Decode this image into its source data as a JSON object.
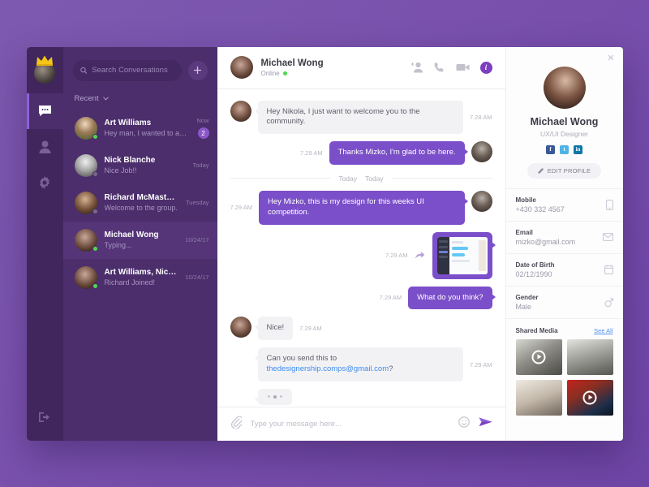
{
  "colors": {
    "accent": "#7b4fc9",
    "rail_bg": "#41265e",
    "sidebar_bg": "#4b2e6b",
    "selected_row": "#553578",
    "link": "#3d8cf0",
    "online": "#4ddb4d"
  },
  "rail": {
    "avatar_name": "user-avatar-crown",
    "items": [
      {
        "icon": "chat-bubble-icon",
        "name": "rail-item-chats",
        "active": true
      },
      {
        "icon": "person-icon",
        "name": "rail-item-contacts",
        "active": false
      },
      {
        "icon": "gear-icon",
        "name": "rail-item-settings",
        "active": false
      }
    ],
    "logout_icon": "logout-icon"
  },
  "sidebar": {
    "search": {
      "placeholder": "Search Conversations",
      "value": "",
      "icon": "search-icon"
    },
    "add_button_icon": "plus-icon",
    "filter_label": "Recent",
    "filter_chevron": "chevron-down-icon",
    "conversations": [
      {
        "name": "Art Williams",
        "preview": "Hey man, I wanted to ask...",
        "time": "Now",
        "badge": "2",
        "online": true,
        "selected": false
      },
      {
        "name": "Nick Blanche",
        "preview": "Nice Job!!",
        "time": "Today",
        "badge": "",
        "online": false,
        "selected": false
      },
      {
        "name": "Richard McMasters",
        "preview": "Welcome to the group.",
        "time": "Tuesday",
        "badge": "",
        "online": false,
        "selected": false
      },
      {
        "name": "Michael Wong",
        "preview": "Typing...",
        "time": "10/24/17",
        "badge": "",
        "online": true,
        "selected": true
      },
      {
        "name": "Art Williams, Nick B...",
        "preview": "Richard Joined!",
        "time": "10/24/17",
        "badge": "",
        "online": true,
        "selected": false
      }
    ]
  },
  "chat_header": {
    "name": "Michael Wong",
    "status": "Online",
    "actions": [
      {
        "icon": "add-person-icon",
        "name": "add-person-button"
      },
      {
        "icon": "phone-icon",
        "name": "voice-call-button"
      },
      {
        "icon": "video-camera-icon",
        "name": "video-call-button"
      }
    ],
    "info_label": "i"
  },
  "messages": [
    {
      "type": "text",
      "dir": "in",
      "text": "Hey Nikola, I just want to welcome you to the community.",
      "time": "7.28 AM",
      "avatar": true
    },
    {
      "type": "text",
      "dir": "out",
      "text": "Thanks Mizko, I'm glad to be here.",
      "time": "7.29 AM",
      "avatar": true
    },
    {
      "type": "divider",
      "label": "Today"
    },
    {
      "type": "text",
      "dir": "out",
      "text": "Hey Mizko, this is my design for this weeks UI competition.",
      "time": "7.29 AM",
      "avatar": true
    },
    {
      "type": "attachment",
      "dir": "out",
      "time": "7.29 AM",
      "forward_icon": "forward-arrow-icon",
      "attachment_name": "design-screenshot-thumbnail"
    },
    {
      "type": "text",
      "dir": "out",
      "text": "What do you think?",
      "time": "7.29 AM",
      "avatar": false
    },
    {
      "type": "text",
      "dir": "in",
      "text": "Nice!",
      "time": "7.29 AM",
      "avatar": true
    },
    {
      "type": "link",
      "dir": "in",
      "text_before": "Can you send this to ",
      "link_text": "thedesignership.comps@gmail.com",
      "text_after": "?",
      "time": "7.29 AM",
      "avatar": false
    },
    {
      "type": "typing",
      "dir": "in"
    }
  ],
  "composer": {
    "attach_icon": "paperclip-icon",
    "placeholder": "Type your message here...",
    "value": "",
    "emoji_icon": "emoji-smiley-icon",
    "send_icon": "send-paper-plane-icon"
  },
  "profile": {
    "close_icon": "close-icon",
    "name": "Michael Wong",
    "role": "UX/UI Designer",
    "socials": [
      {
        "name": "facebook-icon",
        "glyph": "f",
        "color": "#3b5998"
      },
      {
        "name": "twitter-icon",
        "glyph": "t",
        "color": "#4fb3e8"
      },
      {
        "name": "linkedin-icon",
        "glyph": "in",
        "color": "#0e76a8"
      }
    ],
    "edit_button": {
      "label": "EDIT PROFILE",
      "icon": "edit-pencil-icon"
    },
    "fields": [
      {
        "label": "Mobile",
        "value": "+430 332 4567",
        "icon": "mobile-phone-icon"
      },
      {
        "label": "Email",
        "value": "mizko@gmail.com",
        "icon": "envelope-icon"
      },
      {
        "label": "Date of Birth",
        "value": "02/12/1990",
        "icon": "calendar-icon"
      },
      {
        "label": "Gender",
        "value": "Male",
        "icon": "gender-icon"
      }
    ],
    "media": {
      "title": "Shared Media",
      "see_all": "See All",
      "items": [
        {
          "name": "media-thumbnail-temple",
          "video": true
        },
        {
          "name": "media-thumbnail-cathedral",
          "video": false
        },
        {
          "name": "media-thumbnail-portrait",
          "video": false
        },
        {
          "name": "media-thumbnail-city-night",
          "video": true
        }
      ]
    }
  }
}
